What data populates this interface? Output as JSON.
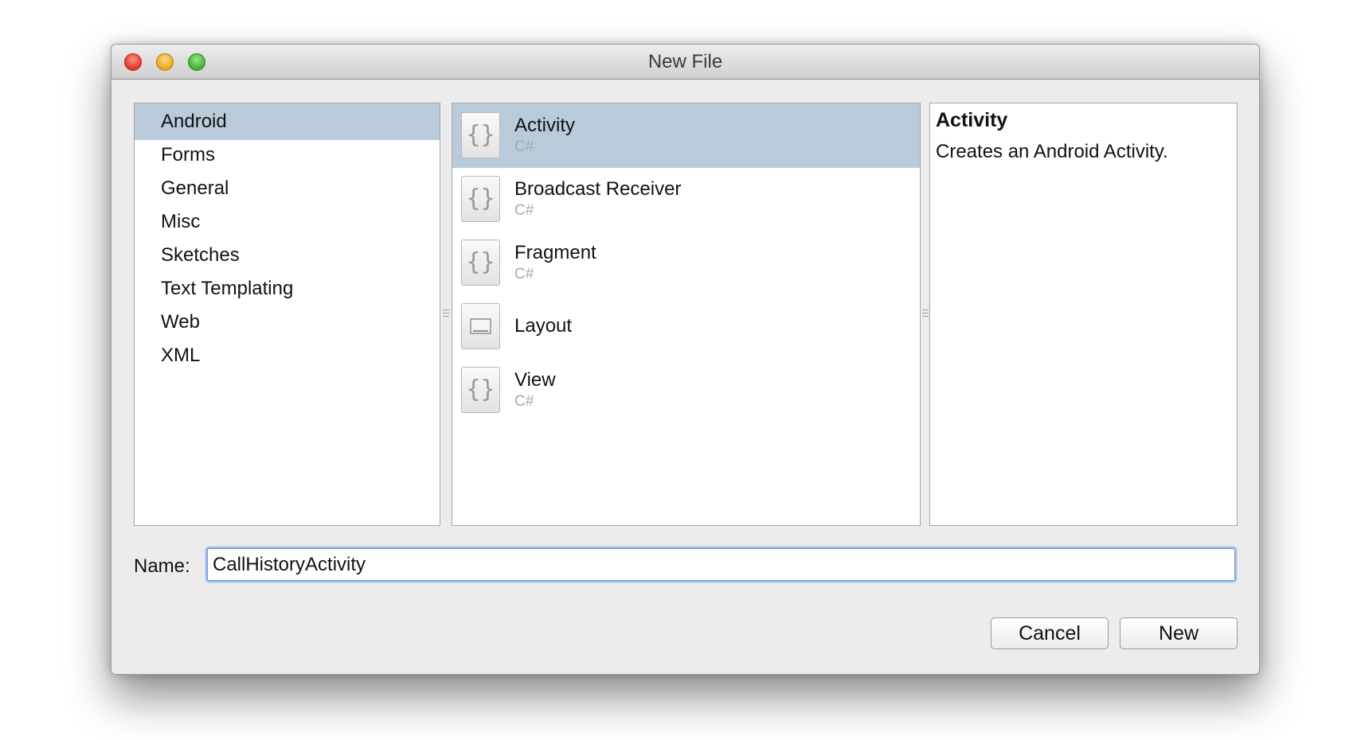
{
  "window": {
    "title": "New File"
  },
  "categories": [
    {
      "label": "Android",
      "selected": true
    },
    {
      "label": "Forms",
      "selected": false
    },
    {
      "label": "General",
      "selected": false
    },
    {
      "label": "Misc",
      "selected": false
    },
    {
      "label": "Sketches",
      "selected": false
    },
    {
      "label": "Text Templating",
      "selected": false
    },
    {
      "label": "Web",
      "selected": false
    },
    {
      "label": "XML",
      "selected": false
    }
  ],
  "templates": [
    {
      "name": "Activity",
      "language": "C#",
      "icon": "code-braces-icon",
      "selected": true
    },
    {
      "name": "Broadcast Receiver",
      "language": "C#",
      "icon": "code-braces-icon",
      "selected": false
    },
    {
      "name": "Fragment",
      "language": "C#",
      "icon": "code-braces-icon",
      "selected": false
    },
    {
      "name": "Layout",
      "language": "",
      "icon": "layout-icon",
      "selected": false
    },
    {
      "name": "View",
      "language": "C#",
      "icon": "code-braces-icon",
      "selected": false
    }
  ],
  "description": {
    "title": "Activity",
    "text": "Creates an Android Activity."
  },
  "name_field": {
    "label": "Name:",
    "value": "CallHistoryActivity"
  },
  "buttons": {
    "cancel": "Cancel",
    "new": "New"
  },
  "colors": {
    "selection": "#b9cbdb",
    "focus_ring": "#7aa7e0",
    "close": "#e0362c",
    "minimize": "#e6a420",
    "zoom": "#3eae2e"
  }
}
